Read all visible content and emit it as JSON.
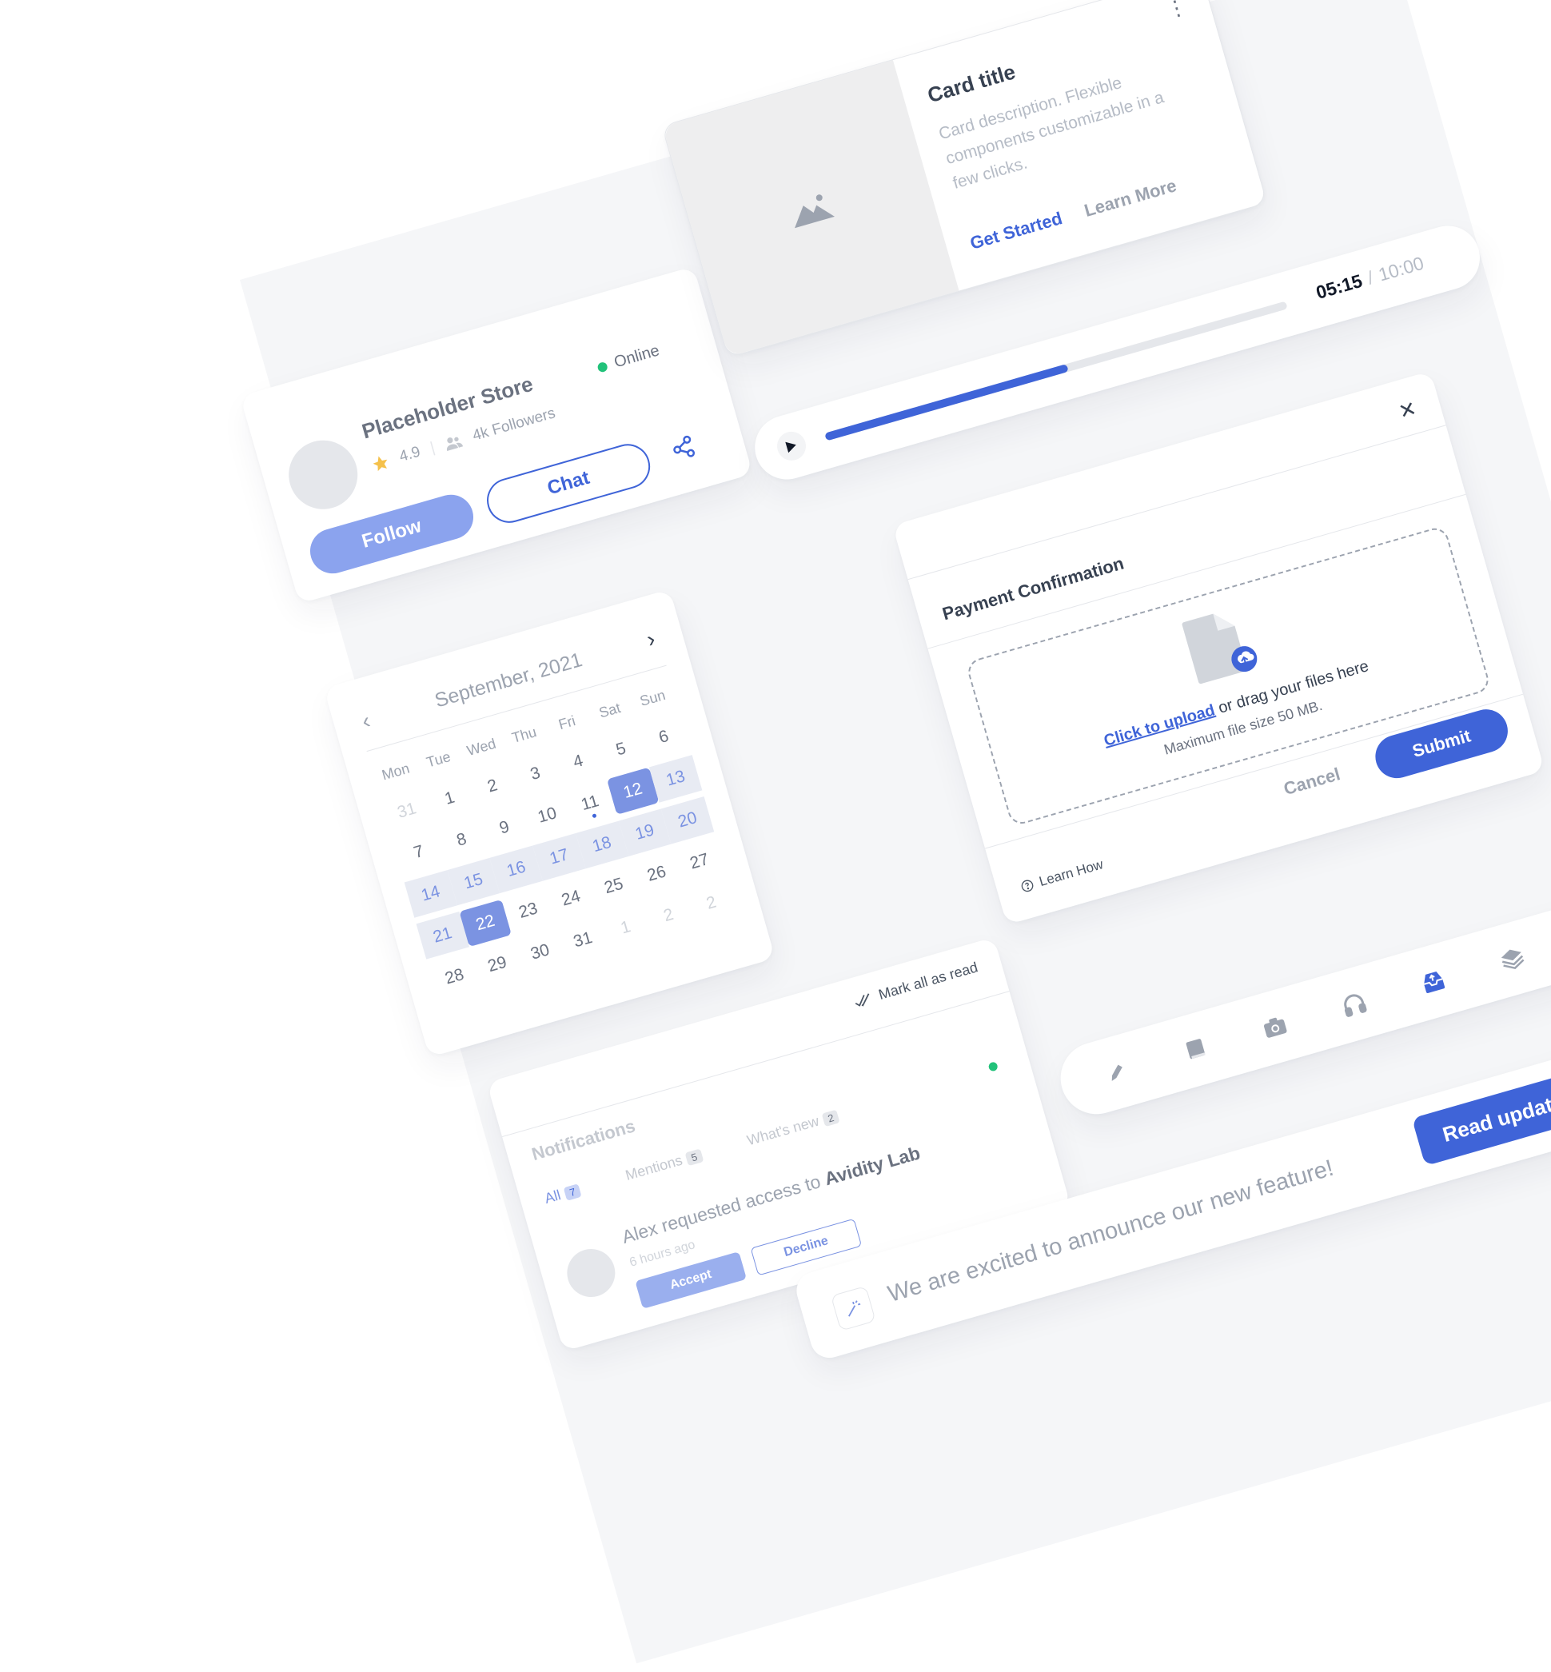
{
  "store": {
    "name": "Placeholder Store",
    "status": "Online",
    "rating": "4.9",
    "followers": "4k Followers",
    "follow_label": "Follow",
    "chat_label": "Chat"
  },
  "product": {
    "title": "Card title",
    "description": "Card description. Flexible components customizable in a few clicks.",
    "primary_action": "Get Started",
    "secondary_action": "Learn More"
  },
  "player": {
    "current": "05:15",
    "separator": "/",
    "total": "10:00",
    "progress": 0.525
  },
  "payment": {
    "title": "Payment Confirmation",
    "upload_link": "Click to upload",
    "upload_text": " or drag your files here",
    "max_size": "Maximum file size 50 MB.",
    "learn_how": "Learn How",
    "cancel_label": "Cancel",
    "submit_label": "Submit"
  },
  "calendar": {
    "month": "September, 2021",
    "weekdays": [
      "Mon",
      "Tue",
      "Wed",
      "Thu",
      "Fri",
      "Sat",
      "Sun"
    ],
    "days": [
      {
        "d": "31",
        "t": "out"
      },
      {
        "d": "1"
      },
      {
        "d": "2"
      },
      {
        "d": "3"
      },
      {
        "d": "4"
      },
      {
        "d": "5"
      },
      {
        "d": "6"
      },
      {
        "d": "7"
      },
      {
        "d": "8"
      },
      {
        "d": "9"
      },
      {
        "d": "10"
      },
      {
        "d": "11",
        "t": "today"
      },
      {
        "d": "12",
        "t": "sel"
      },
      {
        "d": "13",
        "t": "range"
      },
      {
        "d": "14",
        "t": "range"
      },
      {
        "d": "15",
        "t": "range"
      },
      {
        "d": "16",
        "t": "range"
      },
      {
        "d": "17",
        "t": "range"
      },
      {
        "d": "18",
        "t": "range"
      },
      {
        "d": "19",
        "t": "range"
      },
      {
        "d": "20",
        "t": "range"
      },
      {
        "d": "21",
        "t": "range"
      },
      {
        "d": "22",
        "t": "sel"
      },
      {
        "d": "23"
      },
      {
        "d": "24"
      },
      {
        "d": "25"
      },
      {
        "d": "26"
      },
      {
        "d": "27"
      },
      {
        "d": "28"
      },
      {
        "d": "29"
      },
      {
        "d": "30"
      },
      {
        "d": "31"
      },
      {
        "d": "1",
        "t": "out"
      },
      {
        "d": "2",
        "t": "out"
      },
      {
        "d": "2",
        "t": "out"
      }
    ]
  },
  "notifications": {
    "title": "Notifications",
    "mark_all": "Mark all as read",
    "tabs": [
      {
        "label": "All",
        "count": "7"
      },
      {
        "label": "Mentions",
        "count": "5"
      },
      {
        "label": "What's new",
        "count": "2"
      }
    ],
    "message_prefix": "Alex requested access to ",
    "message_target": "Avidity Lab",
    "time_ago": "6 hours ago",
    "accept_label": "Accept",
    "decline_label": "Decline"
  },
  "toolbar": {
    "icons": [
      "pen-icon",
      "book-icon",
      "camera-icon",
      "headphones-icon",
      "inbox-icon",
      "layers-icon",
      "compass-icon"
    ],
    "active": "inbox-icon"
  },
  "announcement": {
    "text": "We are excited to announce our new feature!",
    "button_label": "Read update"
  },
  "colors": {
    "accent": "#3f64d8",
    "accent_light": "#7b93e2",
    "online": "#22c27a",
    "board": "#f5f6f8"
  }
}
